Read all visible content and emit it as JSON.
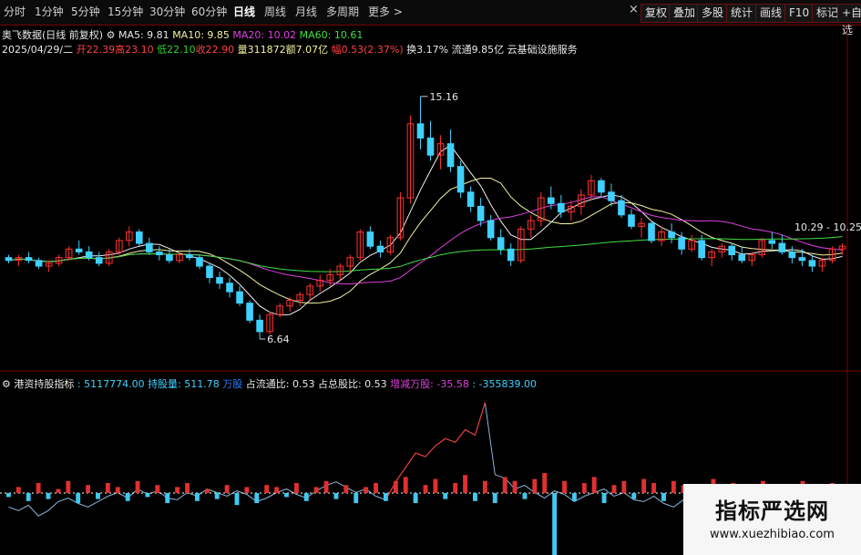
{
  "toolbar": {
    "periods": [
      "分时",
      "1分钟",
      "5分钟",
      "15分钟",
      "30分钟",
      "60分钟",
      "日线",
      "周线",
      "月线",
      "多周期",
      "更多"
    ],
    "active_period": "日线",
    "close_glyph": "×",
    "buttons": [
      "复权",
      "叠加",
      "多股",
      "统计",
      "画线",
      "F10",
      "标记",
      "+自选"
    ]
  },
  "stock": {
    "title": "奥飞数据(日线 前复权)",
    "ma5": "MA5: 9.81",
    "ma10": "MA10: 9.85",
    "ma20": "MA20: 10.02",
    "ma60": "MA60: 10.61",
    "date": "2025/04/29/二",
    "open": "开22.39",
    "high": "高23.10",
    "low": "低22.10",
    "close": "收22.90",
    "volume": "量311872",
    "amount": "额7.07亿",
    "change": "幅0.53(2.37%)",
    "turnover": "换3.17%",
    "float": "流通9.85亿",
    "sector": "云基础设施服务",
    "colors": {
      "ma5": "#f0f0f0",
      "ma10": "#f2f2a0",
      "ma20": "#e040e0",
      "ma60": "#40e040",
      "up": "#ff3030",
      "down": "#40d0ff"
    }
  },
  "indicator": {
    "name": "港资持股指标",
    "v1": ": 5117774.00",
    "hold_label": "持股量",
    "hold_value": ": 511.78",
    "unit": "万股",
    "float_ratio": "占流通比: 0.53",
    "total_ratio": "占总股比: 0.53",
    "change_label": "增减万股",
    "change_value": ": -35.58",
    "last": ": -355839.00"
  },
  "chart_data": {
    "type": "candlestick",
    "price_annotations": {
      "high": "15.16",
      "low": "6.64",
      "right": "10.29 - 10.25"
    },
    "price_range": [
      6.0,
      16.5
    ],
    "candles": [
      [
        9.5,
        9.6,
        9.3,
        9.4
      ],
      [
        9.4,
        9.6,
        9.2,
        9.5
      ],
      [
        9.5,
        9.7,
        9.3,
        9.4
      ],
      [
        9.4,
        9.5,
        9.1,
        9.2
      ],
      [
        9.2,
        9.4,
        9.0,
        9.3
      ],
      [
        9.3,
        9.6,
        9.2,
        9.5
      ],
      [
        9.5,
        9.9,
        9.4,
        9.8
      ],
      [
        9.8,
        10.1,
        9.6,
        9.7
      ],
      [
        9.7,
        9.9,
        9.4,
        9.5
      ],
      [
        9.5,
        9.7,
        9.2,
        9.3
      ],
      [
        9.3,
        9.8,
        9.2,
        9.7
      ],
      [
        9.7,
        10.2,
        9.6,
        10.1
      ],
      [
        10.1,
        10.6,
        9.9,
        10.4
      ],
      [
        10.4,
        10.5,
        9.9,
        10.0
      ],
      [
        10.0,
        10.2,
        9.6,
        9.7
      ],
      [
        9.7,
        9.9,
        9.4,
        9.6
      ],
      [
        9.6,
        9.8,
        9.3,
        9.4
      ],
      [
        9.4,
        9.7,
        9.3,
        9.6
      ],
      [
        9.6,
        9.8,
        9.4,
        9.5
      ],
      [
        9.5,
        9.6,
        9.1,
        9.2
      ],
      [
        9.2,
        9.3,
        8.6,
        8.8
      ],
      [
        8.8,
        9.0,
        8.4,
        8.6
      ],
      [
        8.6,
        8.8,
        8.1,
        8.3
      ],
      [
        8.3,
        8.5,
        7.8,
        7.9
      ],
      [
        7.9,
        8.0,
        7.2,
        7.3
      ],
      [
        7.3,
        7.5,
        6.64,
        6.9
      ],
      [
        6.9,
        7.6,
        6.8,
        7.5
      ],
      [
        7.5,
        7.9,
        7.4,
        7.8
      ],
      [
        7.8,
        8.1,
        7.6,
        8.0
      ],
      [
        8.0,
        8.3,
        7.8,
        8.2
      ],
      [
        8.2,
        8.6,
        8.0,
        8.5
      ],
      [
        8.5,
        8.9,
        8.3,
        8.7
      ],
      [
        8.7,
        9.1,
        8.5,
        8.9
      ],
      [
        8.9,
        9.3,
        8.7,
        9.2
      ],
      [
        9.2,
        9.6,
        9.0,
        9.5
      ],
      [
        9.5,
        10.5,
        9.4,
        10.4
      ],
      [
        10.4,
        10.6,
        9.8,
        9.9
      ],
      [
        9.9,
        10.1,
        9.5,
        9.7
      ],
      [
        9.7,
        10.3,
        9.6,
        10.2
      ],
      [
        10.2,
        11.8,
        10.1,
        11.6
      ],
      [
        11.6,
        14.5,
        11.4,
        14.2
      ],
      [
        14.2,
        15.16,
        13.3,
        13.7
      ],
      [
        13.7,
        14.3,
        12.9,
        13.1
      ],
      [
        13.1,
        13.8,
        12.6,
        13.5
      ],
      [
        13.5,
        14.0,
        12.5,
        12.7
      ],
      [
        12.7,
        12.9,
        11.6,
        11.8
      ],
      [
        11.8,
        12.0,
        11.1,
        11.3
      ],
      [
        11.3,
        11.6,
        10.6,
        10.8
      ],
      [
        10.8,
        11.0,
        10.1,
        10.2
      ],
      [
        10.2,
        10.5,
        9.6,
        9.8
      ],
      [
        9.8,
        10.0,
        9.2,
        9.4
      ],
      [
        9.4,
        10.6,
        9.3,
        10.5
      ],
      [
        10.5,
        11.0,
        10.2,
        10.8
      ],
      [
        10.8,
        11.8,
        10.6,
        11.6
      ],
      [
        11.6,
        12.0,
        11.2,
        11.4
      ],
      [
        11.4,
        11.7,
        10.9,
        11.1
      ],
      [
        11.1,
        11.5,
        10.8,
        11.3
      ],
      [
        11.3,
        11.9,
        11.0,
        11.7
      ],
      [
        11.7,
        12.4,
        11.5,
        12.2
      ],
      [
        12.2,
        12.3,
        11.6,
        11.8
      ],
      [
        11.8,
        12.1,
        11.3,
        11.5
      ],
      [
        11.5,
        11.7,
        10.9,
        11.0
      ],
      [
        11.0,
        11.2,
        10.5,
        10.6
      ],
      [
        10.6,
        10.9,
        10.2,
        10.7
      ],
      [
        10.7,
        10.8,
        10.0,
        10.1
      ],
      [
        10.1,
        10.6,
        9.9,
        10.4
      ],
      [
        10.4,
        10.7,
        10.0,
        10.2
      ],
      [
        10.2,
        10.4,
        9.6,
        9.8
      ],
      [
        9.8,
        10.3,
        9.7,
        10.1
      ],
      [
        10.1,
        10.3,
        9.4,
        9.5
      ],
      [
        9.5,
        9.8,
        9.2,
        9.7
      ],
      [
        9.7,
        10.0,
        9.5,
        9.9
      ],
      [
        9.9,
        10.0,
        9.4,
        9.6
      ],
      [
        9.6,
        9.9,
        9.3,
        9.4
      ],
      [
        9.4,
        9.7,
        9.2,
        9.6
      ],
      [
        9.6,
        10.2,
        9.5,
        10.1
      ],
      [
        10.1,
        10.4,
        9.8,
        10.0
      ],
      [
        10.0,
        10.3,
        9.6,
        9.7
      ],
      [
        9.7,
        9.9,
        9.3,
        9.5
      ],
      [
        9.5,
        9.8,
        9.2,
        9.4
      ],
      [
        9.4,
        9.6,
        9.0,
        9.2
      ],
      [
        9.2,
        9.5,
        9.0,
        9.4
      ],
      [
        9.4,
        9.9,
        9.3,
        9.8
      ],
      [
        9.8,
        10.0,
        9.6,
        9.9
      ]
    ],
    "hold_series": [
      0.52,
      0.5,
      0.53,
      0.47,
      0.5,
      0.55,
      0.57,
      0.54,
      0.52,
      0.55,
      0.58,
      0.6,
      0.57,
      0.62,
      0.59,
      0.61,
      0.57,
      0.56,
      0.6,
      0.58,
      0.62,
      0.6,
      0.58,
      0.61,
      0.59,
      0.55,
      0.57,
      0.6,
      0.62,
      0.59,
      0.57,
      0.61,
      0.64,
      0.66,
      0.63,
      0.6,
      0.62,
      0.58,
      0.56,
      0.66,
      0.74,
      0.82,
      0.8,
      0.86,
      0.9,
      0.88,
      0.95,
      0.92,
      1.1,
      0.7,
      0.68,
      0.62,
      0.64,
      0.6,
      0.57,
      0.61,
      0.59,
      0.55,
      0.58,
      0.6,
      0.62,
      0.58,
      0.6,
      0.56,
      0.55,
      0.58,
      0.54,
      0.52,
      0.56,
      0.53,
      0.5,
      0.54,
      0.56,
      0.51,
      0.53,
      0.55,
      0.52,
      0.5,
      0.54,
      0.52,
      0.5,
      0.53,
      0.51,
      0.52,
      0.5
    ],
    "change_bars": [
      -0.2,
      0.3,
      -0.4,
      0.5,
      -0.3,
      0.2,
      0.6,
      -0.5,
      0.4,
      -0.3,
      0.5,
      0.3,
      -0.4,
      0.6,
      -0.2,
      0.4,
      -0.5,
      0.3,
      0.5,
      -0.4,
      0.2,
      -0.3,
      0.4,
      -0.6,
      0.3,
      -0.5,
      0.4,
      0.3,
      -0.2,
      0.5,
      -0.4,
      0.3,
      0.6,
      -0.3,
      0.4,
      -0.5,
      0.3,
      0.5,
      -0.4,
      0.6,
      0.8,
      -0.5,
      0.4,
      0.7,
      -0.3,
      0.5,
      0.9,
      -0.4,
      0.6,
      -0.5,
      0.8,
      0.6,
      -0.3,
      0.7,
      1.0,
      -3.5,
      0.6,
      -0.4,
      0.5,
      0.8,
      -0.5,
      0.4,
      0.6,
      -0.3,
      0.7,
      0.5,
      -0.4,
      0.6,
      0.4,
      -0.5,
      0.3,
      0.7,
      -0.4,
      0.5,
      0.3,
      -0.3,
      0.6,
      0.4,
      -0.5,
      0.3,
      0.6,
      -0.4,
      0.3,
      0.5,
      -0.3
    ]
  }
}
